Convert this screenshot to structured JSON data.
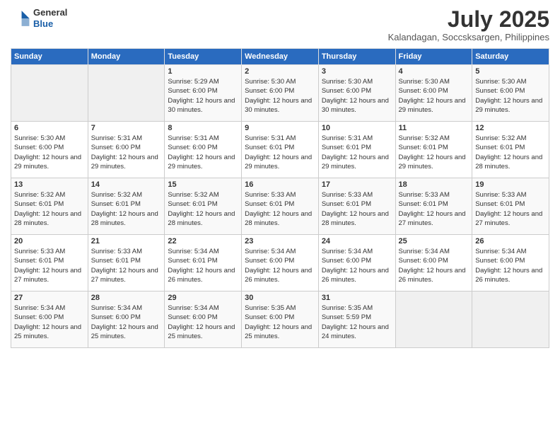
{
  "header": {
    "logo": {
      "general": "General",
      "blue": "Blue"
    },
    "title": "July 2025",
    "subtitle": "Kalandagan, Soccsksargen, Philippines"
  },
  "weekdays": [
    "Sunday",
    "Monday",
    "Tuesday",
    "Wednesday",
    "Thursday",
    "Friday",
    "Saturday"
  ],
  "weeks": [
    [
      {
        "day": "",
        "info": ""
      },
      {
        "day": "",
        "info": ""
      },
      {
        "day": "1",
        "info": "Sunrise: 5:29 AM\nSunset: 6:00 PM\nDaylight: 12 hours and 30 minutes."
      },
      {
        "day": "2",
        "info": "Sunrise: 5:30 AM\nSunset: 6:00 PM\nDaylight: 12 hours and 30 minutes."
      },
      {
        "day": "3",
        "info": "Sunrise: 5:30 AM\nSunset: 6:00 PM\nDaylight: 12 hours and 30 minutes."
      },
      {
        "day": "4",
        "info": "Sunrise: 5:30 AM\nSunset: 6:00 PM\nDaylight: 12 hours and 29 minutes."
      },
      {
        "day": "5",
        "info": "Sunrise: 5:30 AM\nSunset: 6:00 PM\nDaylight: 12 hours and 29 minutes."
      }
    ],
    [
      {
        "day": "6",
        "info": "Sunrise: 5:30 AM\nSunset: 6:00 PM\nDaylight: 12 hours and 29 minutes."
      },
      {
        "day": "7",
        "info": "Sunrise: 5:31 AM\nSunset: 6:00 PM\nDaylight: 12 hours and 29 minutes."
      },
      {
        "day": "8",
        "info": "Sunrise: 5:31 AM\nSunset: 6:00 PM\nDaylight: 12 hours and 29 minutes."
      },
      {
        "day": "9",
        "info": "Sunrise: 5:31 AM\nSunset: 6:01 PM\nDaylight: 12 hours and 29 minutes."
      },
      {
        "day": "10",
        "info": "Sunrise: 5:31 AM\nSunset: 6:01 PM\nDaylight: 12 hours and 29 minutes."
      },
      {
        "day": "11",
        "info": "Sunrise: 5:32 AM\nSunset: 6:01 PM\nDaylight: 12 hours and 29 minutes."
      },
      {
        "day": "12",
        "info": "Sunrise: 5:32 AM\nSunset: 6:01 PM\nDaylight: 12 hours and 28 minutes."
      }
    ],
    [
      {
        "day": "13",
        "info": "Sunrise: 5:32 AM\nSunset: 6:01 PM\nDaylight: 12 hours and 28 minutes."
      },
      {
        "day": "14",
        "info": "Sunrise: 5:32 AM\nSunset: 6:01 PM\nDaylight: 12 hours and 28 minutes."
      },
      {
        "day": "15",
        "info": "Sunrise: 5:32 AM\nSunset: 6:01 PM\nDaylight: 12 hours and 28 minutes."
      },
      {
        "day": "16",
        "info": "Sunrise: 5:33 AM\nSunset: 6:01 PM\nDaylight: 12 hours and 28 minutes."
      },
      {
        "day": "17",
        "info": "Sunrise: 5:33 AM\nSunset: 6:01 PM\nDaylight: 12 hours and 28 minutes."
      },
      {
        "day": "18",
        "info": "Sunrise: 5:33 AM\nSunset: 6:01 PM\nDaylight: 12 hours and 27 minutes."
      },
      {
        "day": "19",
        "info": "Sunrise: 5:33 AM\nSunset: 6:01 PM\nDaylight: 12 hours and 27 minutes."
      }
    ],
    [
      {
        "day": "20",
        "info": "Sunrise: 5:33 AM\nSunset: 6:01 PM\nDaylight: 12 hours and 27 minutes."
      },
      {
        "day": "21",
        "info": "Sunrise: 5:33 AM\nSunset: 6:01 PM\nDaylight: 12 hours and 27 minutes."
      },
      {
        "day": "22",
        "info": "Sunrise: 5:34 AM\nSunset: 6:01 PM\nDaylight: 12 hours and 26 minutes."
      },
      {
        "day": "23",
        "info": "Sunrise: 5:34 AM\nSunset: 6:00 PM\nDaylight: 12 hours and 26 minutes."
      },
      {
        "day": "24",
        "info": "Sunrise: 5:34 AM\nSunset: 6:00 PM\nDaylight: 12 hours and 26 minutes."
      },
      {
        "day": "25",
        "info": "Sunrise: 5:34 AM\nSunset: 6:00 PM\nDaylight: 12 hours and 26 minutes."
      },
      {
        "day": "26",
        "info": "Sunrise: 5:34 AM\nSunset: 6:00 PM\nDaylight: 12 hours and 26 minutes."
      }
    ],
    [
      {
        "day": "27",
        "info": "Sunrise: 5:34 AM\nSunset: 6:00 PM\nDaylight: 12 hours and 25 minutes."
      },
      {
        "day": "28",
        "info": "Sunrise: 5:34 AM\nSunset: 6:00 PM\nDaylight: 12 hours and 25 minutes."
      },
      {
        "day": "29",
        "info": "Sunrise: 5:34 AM\nSunset: 6:00 PM\nDaylight: 12 hours and 25 minutes."
      },
      {
        "day": "30",
        "info": "Sunrise: 5:35 AM\nSunset: 6:00 PM\nDaylight: 12 hours and 25 minutes."
      },
      {
        "day": "31",
        "info": "Sunrise: 5:35 AM\nSunset: 5:59 PM\nDaylight: 12 hours and 24 minutes."
      },
      {
        "day": "",
        "info": ""
      },
      {
        "day": "",
        "info": ""
      }
    ]
  ]
}
